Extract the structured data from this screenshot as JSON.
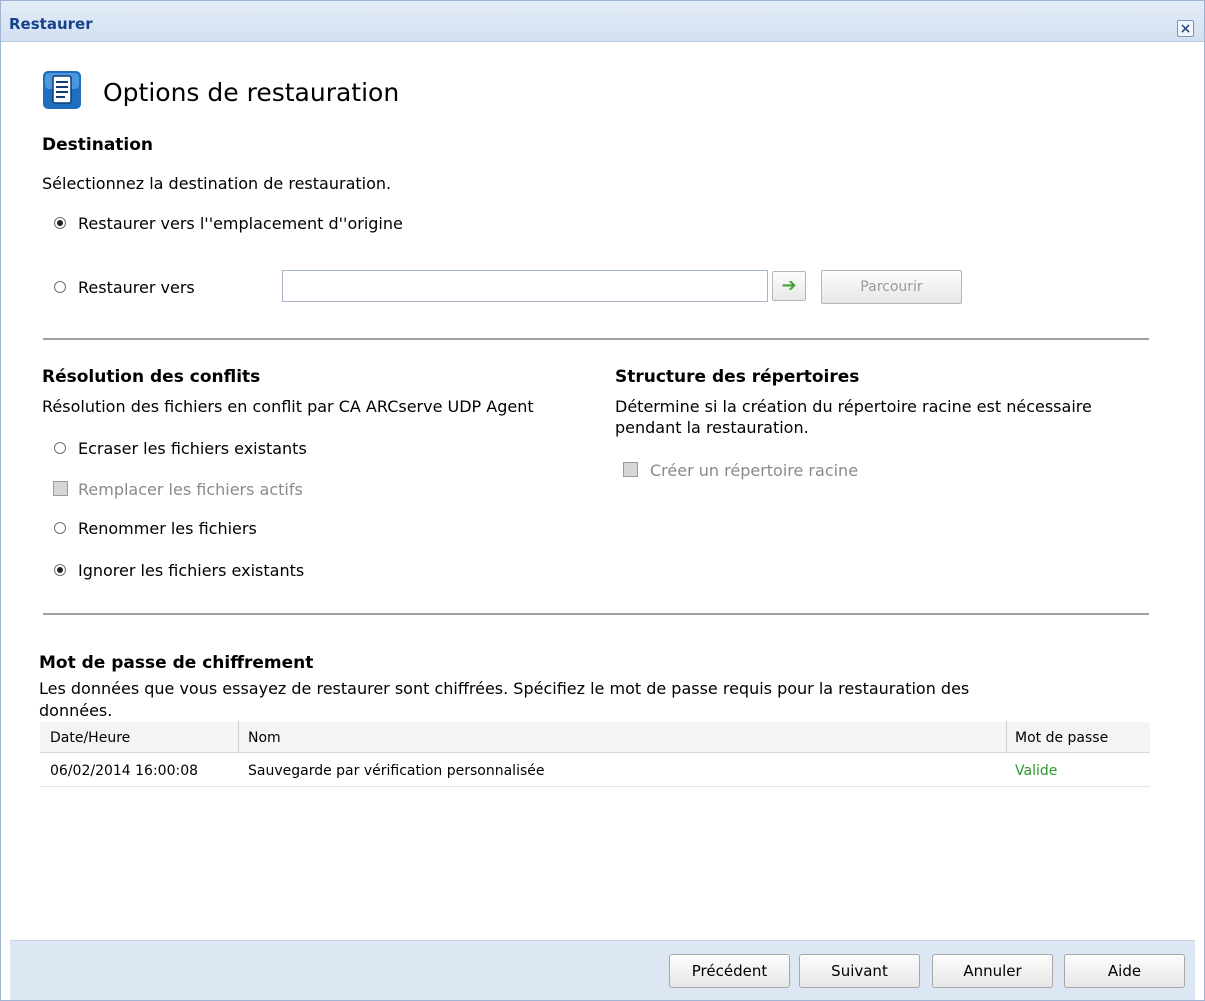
{
  "window": {
    "title": "Restaurer",
    "close_label": "×"
  },
  "page": {
    "title": "Options de restauration",
    "icon": "document-list-icon"
  },
  "destination": {
    "heading": "Destination",
    "description": "Sélectionnez la destination de restauration.",
    "option_original": "Restaurer vers l''emplacement d''origine",
    "option_to": "Restaurer vers",
    "path_value": "",
    "go_label": "➔",
    "browse_label": "Parcourir"
  },
  "conflicts": {
    "heading": "Résolution des conflits",
    "description": "Résolution des fichiers en conflit par CA ARCserve UDP Agent",
    "overwrite": "Ecraser les fichiers existants",
    "replace_active": "Remplacer les fichiers actifs",
    "rename": "Renommer les fichiers",
    "skip": "Ignorer les fichiers existants"
  },
  "directory": {
    "heading": "Structure des répertoires",
    "description_line1": "Détermine si la création du répertoire racine est nécessaire",
    "description_line2": "pendant la restauration.",
    "create_root": "Créer un répertoire racine"
  },
  "encryption": {
    "heading": "Mot de passe de chiffrement",
    "description_line1": "Les données que vous essayez de restaurer sont chiffrées. Spécifiez le mot de passe requis pour la restauration des",
    "description_line2": "données.",
    "columns": {
      "date": "Date/Heure",
      "name": "Nom",
      "password": "Mot de passe"
    },
    "rows": [
      {
        "date": "06/02/2014 16:00:08",
        "name": "Sauvegarde par vérification personnalisée",
        "password": "Valide"
      }
    ]
  },
  "footer": {
    "previous": "Précédent",
    "next": "Suivant",
    "cancel": "Annuler",
    "help": "Aide"
  },
  "colors": {
    "accent": "#15428b",
    "valid": "#2a9a2a",
    "footer_bg": "#dde7f4"
  }
}
